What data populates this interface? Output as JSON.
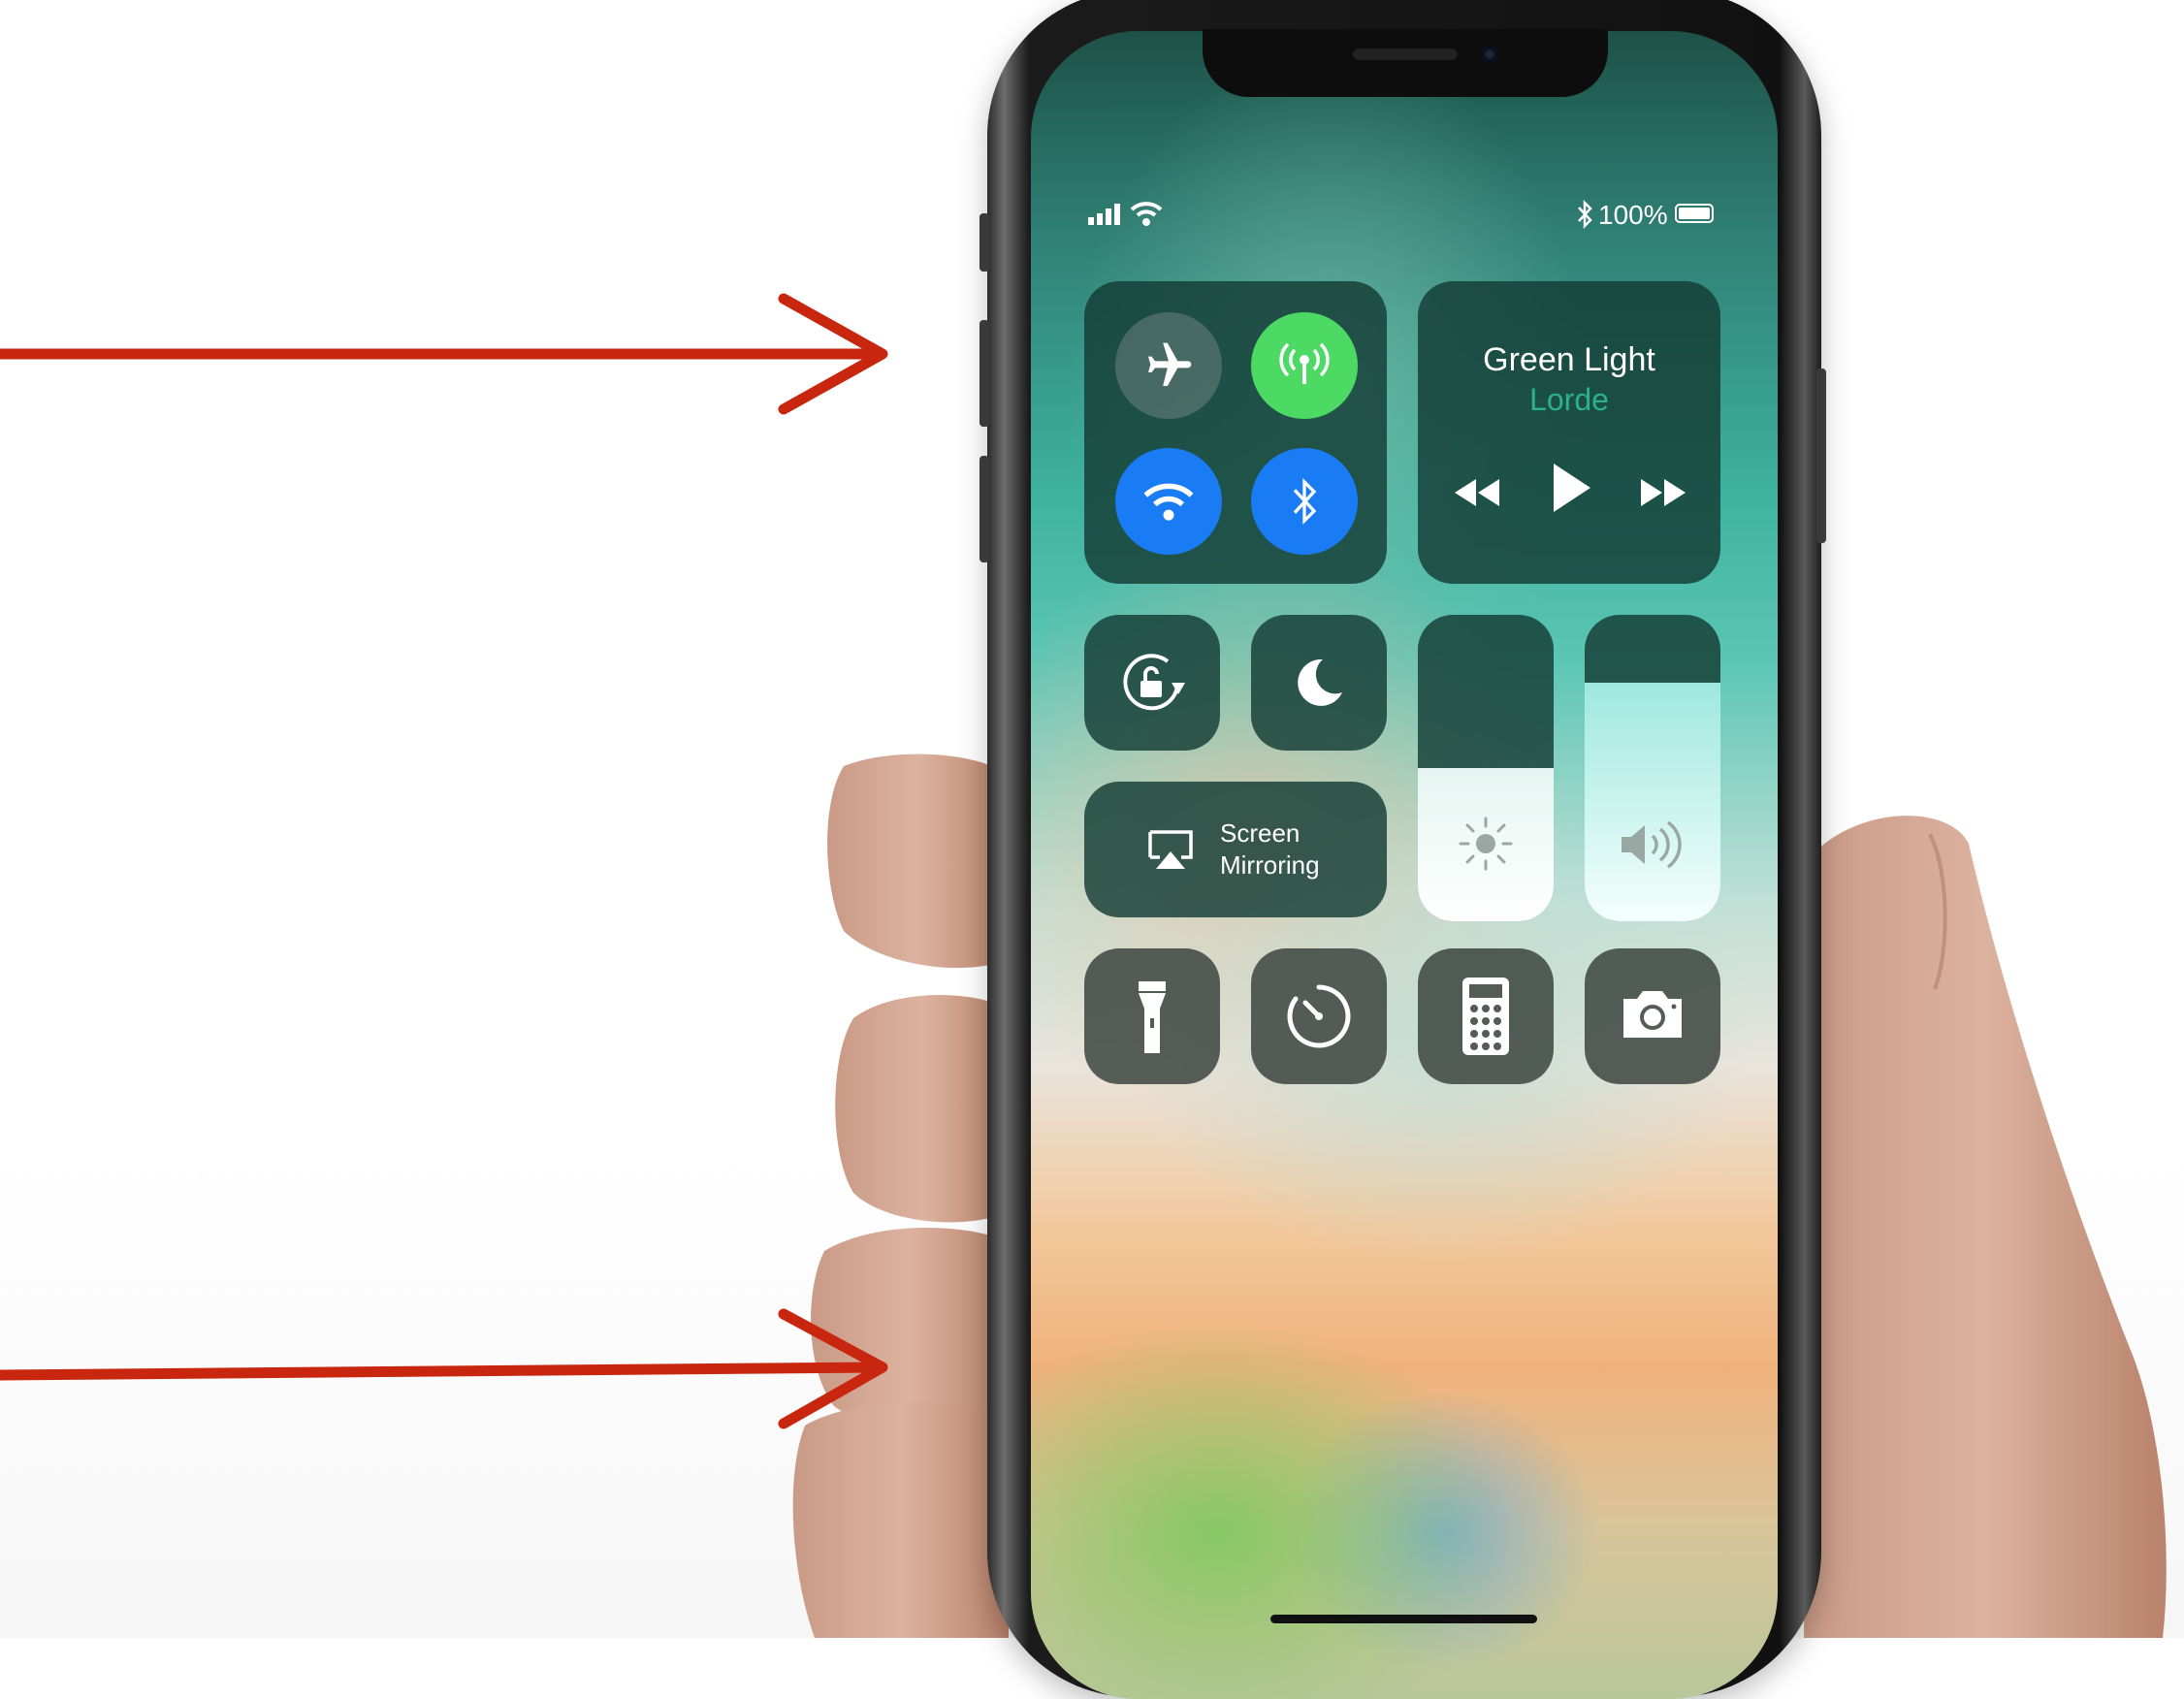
{
  "status_bar": {
    "battery": "100%",
    "icons": [
      "signal-icon",
      "wifi-icon",
      "bluetooth-icon",
      "battery-icon"
    ]
  },
  "control_center": {
    "connectivity": [
      "airplane-mode",
      "cellular-data",
      "wifi",
      "bluetooth"
    ],
    "now_playing": {
      "title": "Green Light",
      "artist": "Lorde",
      "controls": [
        "rewind",
        "play",
        "fast-forward"
      ]
    },
    "toggles": [
      "orientation-lock",
      "do-not-disturb"
    ],
    "screen_mirroring": {
      "line1": "Screen",
      "line2": "Mirroring"
    },
    "brightness_level": 0.5,
    "volume_level": 0.78,
    "shortcuts": [
      "flashlight",
      "timer",
      "calculator",
      "camera"
    ]
  },
  "colors": {
    "arrow": "#c8260f",
    "accent_green": "#4cd964",
    "accent_blue": "#1a7cf5",
    "artist_text": "#2bb28a"
  }
}
